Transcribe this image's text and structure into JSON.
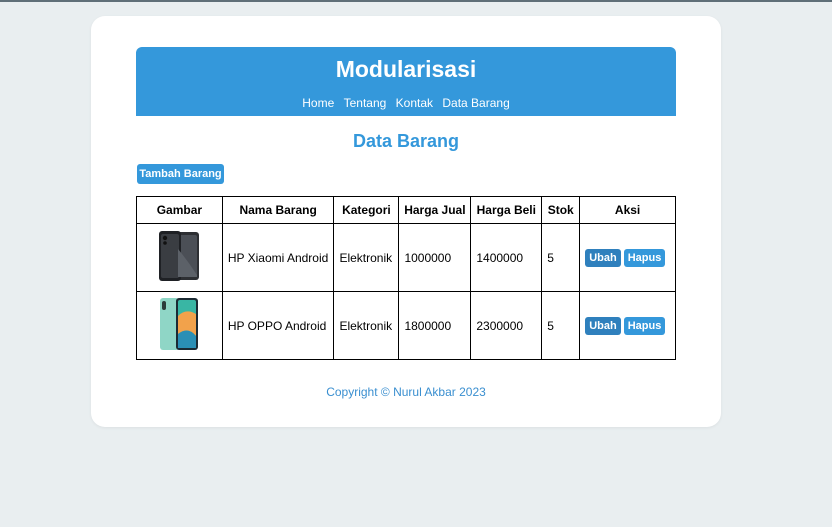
{
  "header": {
    "title": "Modularisasi",
    "nav": [
      "Home",
      "Tentang",
      "Kontak",
      "Data Barang"
    ]
  },
  "page_title": "Data Barang",
  "add_button": "Tambah Barang",
  "table": {
    "columns": [
      "Gambar",
      "Nama Barang",
      "Kategori",
      "Harga Jual",
      "Harga Beli",
      "Stok",
      "Aksi"
    ],
    "rows": [
      {
        "image": "phone-dark-icon",
        "nama": "HP Xiaomi Android",
        "kategori": "Elektronik",
        "harga_jual": "1000000",
        "harga_beli": "1400000",
        "stok": "5"
      },
      {
        "image": "phone-teal-icon",
        "nama": "HP OPPO Android",
        "kategori": "Elektronik",
        "harga_jual": "1800000",
        "harga_beli": "2300000",
        "stok": "5"
      }
    ],
    "actions": {
      "edit": "Ubah",
      "delete": "Hapus"
    }
  },
  "footer": "Copyright © Nurul Akbar 2023",
  "colors": {
    "accent": "#3498db",
    "background": "#e9eef0"
  }
}
